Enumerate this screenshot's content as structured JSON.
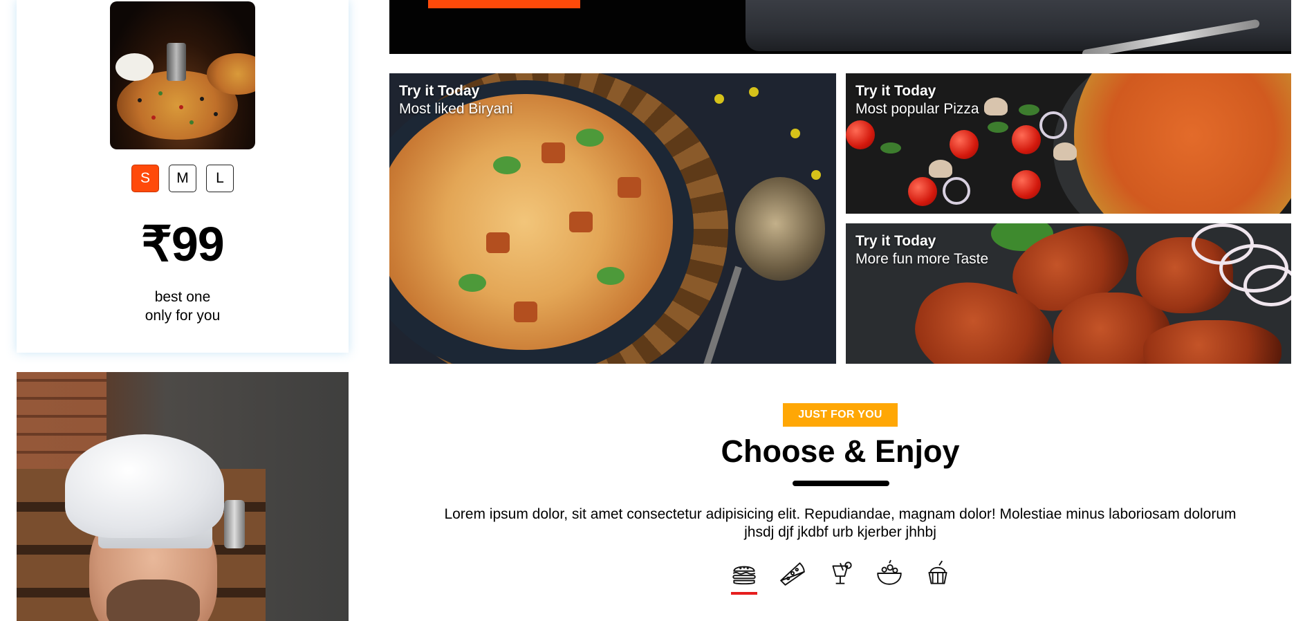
{
  "product_card": {
    "sizes": [
      {
        "label": "S",
        "selected": true
      },
      {
        "label": "M",
        "selected": false
      },
      {
        "label": "L",
        "selected": false
      }
    ],
    "price": "₹99",
    "tagline_line1": "best one",
    "tagline_line2": "only for you"
  },
  "promo_tiles": [
    {
      "title": "Try it Today",
      "subtitle": "Most liked Biryani"
    },
    {
      "title": "Try it Today",
      "subtitle": "Most popular Pizza"
    },
    {
      "title": "Try it Today",
      "subtitle": "More fun more Taste"
    }
  ],
  "section": {
    "badge": "JUST FOR YOU",
    "heading": "Choose & Enjoy",
    "description": "Lorem ipsum dolor, sit amet consectetur adipisicing elit. Repudiandae, magnam dolor! Molestiae minus laboriosam dolorum jhsdj djf jkdbf urb kjerber jhhbj"
  },
  "categories": [
    {
      "icon": "burger-icon",
      "active": true
    },
    {
      "icon": "pizza-slice-icon",
      "active": false
    },
    {
      "icon": "cocktail-icon",
      "active": false
    },
    {
      "icon": "salad-bowl-icon",
      "active": false
    },
    {
      "icon": "ice-cream-icon",
      "active": false
    }
  ],
  "colors": {
    "accent_orange": "#ff4a0a",
    "badge_yellow": "#ffa705",
    "active_underline": "#e61e1e"
  }
}
